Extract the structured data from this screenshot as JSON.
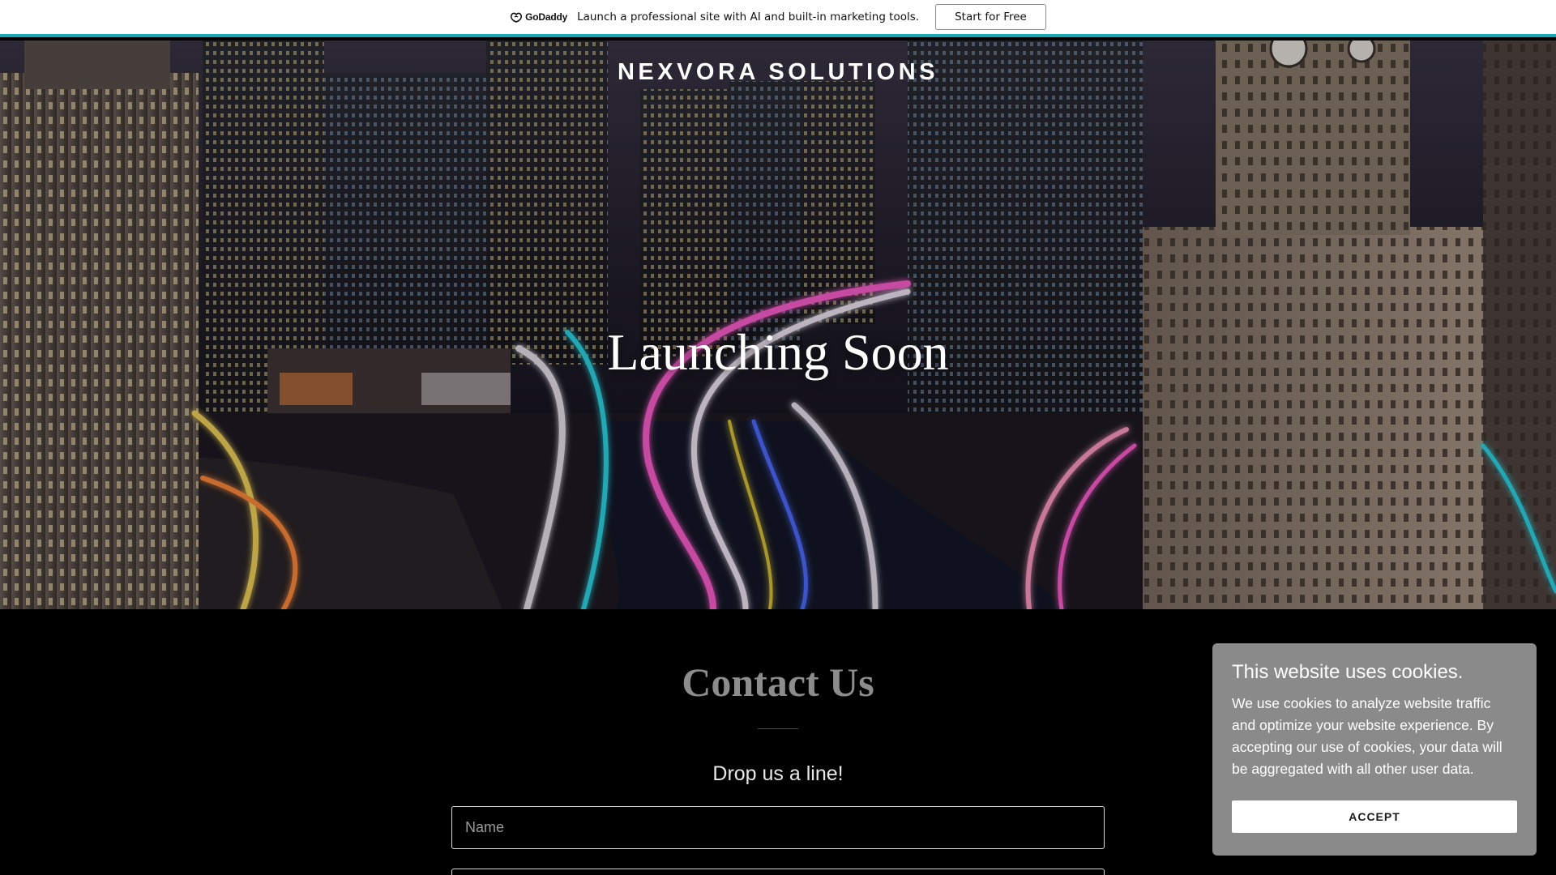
{
  "promo": {
    "logo_text": "GoDaddy",
    "message": "Launch a professional site with AI and built-in marketing tools.",
    "cta_label": "Start for Free",
    "accent_color": "#1ba7b3"
  },
  "hero": {
    "brand": "NEXVORA SOLUTIONS",
    "heading": "Launching Soon"
  },
  "contact": {
    "title": "Contact Us",
    "subtitle": "Drop us a line!",
    "name_placeholder": "Name",
    "email_placeholder": ""
  },
  "cookie": {
    "title": "This website uses cookies.",
    "body": "We use cookies to analyze website traffic and optimize your website experience. By accepting our use of cookies, your data will be aggregated with all other user data.",
    "accept_label": "ACCEPT"
  },
  "icons": {
    "promo_logo": "godaddy-logo-icon"
  }
}
